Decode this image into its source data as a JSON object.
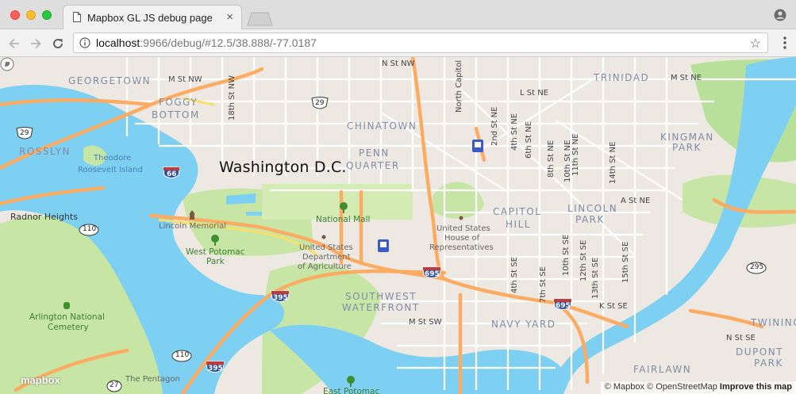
{
  "browser": {
    "tab_title": "Mapbox GL JS debug page",
    "tab_close": "×",
    "url_host": "localhost",
    "url_rest": ":9966/debug/#12.5/38.888/-77.0187",
    "star": "☆"
  },
  "map": {
    "city_label": "Washington D.C.",
    "neighborhoods": [
      {
        "text": "GEORGETOWN"
      },
      {
        "text": "FOGGY"
      },
      {
        "text": "BOTTOM"
      },
      {
        "text": "ROSSLYN"
      },
      {
        "text": "CHINATOWN"
      },
      {
        "text": "PENN"
      },
      {
        "text": "QUARTER"
      },
      {
        "text": "TRINIDAD"
      },
      {
        "text": "KINGMAN"
      },
      {
        "text": "PARK"
      },
      {
        "text": "CAPITOL"
      },
      {
        "text": "HILL"
      },
      {
        "text": "LINCOLN"
      },
      {
        "text": "PARK"
      },
      {
        "text": "SOUTHWEST"
      },
      {
        "text": "WATERFRONT"
      },
      {
        "text": "NAVY YARD"
      },
      {
        "text": "TWINING"
      },
      {
        "text": "DUPONT"
      },
      {
        "text": "PARK"
      },
      {
        "text": "FAIRLAWN"
      }
    ],
    "streets": [
      {
        "text": "N St NW"
      },
      {
        "text": "M St NW"
      },
      {
        "text": "18th St NW"
      },
      {
        "text": "North Capitol"
      },
      {
        "text": "L St NE"
      },
      {
        "text": "2nd St NE"
      },
      {
        "text": "4th St NE"
      },
      {
        "text": "6th St NE"
      },
      {
        "text": "8th St NE"
      },
      {
        "text": "10th St NE"
      },
      {
        "text": "11th St NE"
      },
      {
        "text": "14th St NE"
      },
      {
        "text": "M St NE"
      },
      {
        "text": "A St NE"
      },
      {
        "text": "10th St SE"
      },
      {
        "text": "12th St SE"
      },
      {
        "text": "13th St SE"
      },
      {
        "text": "15th St SE"
      },
      {
        "text": "4th St SE"
      },
      {
        "text": "7th St SE"
      },
      {
        "text": "K St SE"
      },
      {
        "text": "M St SW"
      },
      {
        "text": "N St SE"
      }
    ],
    "pois": [
      {
        "text": "Theodore"
      },
      {
        "text": "Roosevelt Island"
      },
      {
        "text": "Radnor Heights"
      },
      {
        "text": "Lincoln Memorial"
      },
      {
        "text": "National Mall"
      },
      {
        "text": "United States"
      },
      {
        "text": "House of"
      },
      {
        "text": "Representatives"
      },
      {
        "text": "United States"
      },
      {
        "text": "Department"
      },
      {
        "text": "of Agriculture"
      },
      {
        "text": "West Potomac"
      },
      {
        "text": "Park"
      },
      {
        "text": "Arlington National"
      },
      {
        "text": "Cemetery"
      },
      {
        "text": "The Pentagon"
      },
      {
        "text": "East Potomac"
      }
    ],
    "shields": [
      {
        "text": "29",
        "kind": "us"
      },
      {
        "text": "29",
        "kind": "us"
      },
      {
        "text": "66",
        "kind": "interstate"
      },
      {
        "text": "110",
        "kind": "state"
      },
      {
        "text": "110",
        "kind": "state"
      },
      {
        "text": "27",
        "kind": "state"
      },
      {
        "text": "395",
        "kind": "interstate"
      },
      {
        "text": "395",
        "kind": "interstate"
      },
      {
        "text": "695",
        "kind": "interstate"
      },
      {
        "text": "695",
        "kind": "interstate"
      },
      {
        "text": "295",
        "kind": "state"
      }
    ],
    "logo_text": "mapbox",
    "attribution": {
      "copyright_mapbox": "© Mapbox",
      "copyright_osm": "© OpenStreetMap",
      "improve": "Improve this map"
    },
    "colors": {
      "land": "#ede9e2",
      "water": "#7ed0f2",
      "park": "#c7e6a5",
      "major_road": "#fcac62",
      "minor_road": "#ffffff",
      "motorway_shield": "#2d4b9b"
    }
  }
}
